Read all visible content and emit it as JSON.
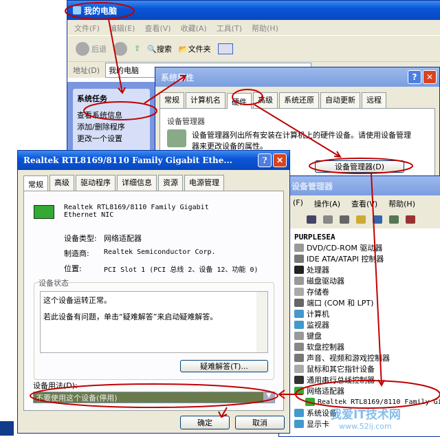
{
  "explorer": {
    "title": "我的电脑",
    "menu": [
      "文件(F)",
      "编辑(E)",
      "查看(V)",
      "收藏(A)",
      "工具(T)",
      "帮助(H)"
    ],
    "back": "后退",
    "search": "搜索",
    "folders": "文件夹",
    "address_label": "地址(D)",
    "address_value": "我的电脑",
    "task_title": "系统任务",
    "tasks": [
      "查看系统信息",
      "添加/删除程序",
      "更改一个设置"
    ]
  },
  "sysprops": {
    "title": "系统属性",
    "tabs": [
      "常规",
      "计算机名",
      "硬件",
      "高级",
      "系统还原",
      "自动更新",
      "远程"
    ],
    "group": "设备管理器",
    "desc": "设备管理器列出所有安装在计算机上的硬件设备。请使用设备管理器来更改设备的属性。",
    "button": "设备管理器(D)"
  },
  "devmgr": {
    "title": "设备管理器",
    "menu": [
      "(F)",
      "操作(A)",
      "查看(V)",
      "帮助(H)"
    ],
    "root": "PURPLESEA",
    "items": [
      "DVD/CD-ROM 驱动器",
      "IDE ATA/ATAPI 控制器",
      "处理器",
      "磁盘驱动器",
      "存储卷",
      "端口 (COM 和 LPT)",
      "计算机",
      "监视器",
      "键盘",
      "软盘控制器",
      "声音、视频和游戏控制器",
      "鼠标和其它指针设备",
      "通用串行总线控制器",
      "网络适配器"
    ],
    "child": "Realtek RTL8169/8110 Family Gi",
    "after": [
      "系统设备",
      "显示卡"
    ]
  },
  "nicprops": {
    "title": "Realtek RTL8169/8110 Family Gigabit Ethe...",
    "tabs": [
      "常规",
      "高级",
      "驱动程序",
      "详细信息",
      "资源",
      "电源管理"
    ],
    "device_name": "Realtek RTL8169/8110 Family Gigabit Ethernet NIC",
    "type_label": "设备类型:",
    "type_value": "网络适配器",
    "mfr_label": "制造商:",
    "mfr_value": "Realtek Semiconductor Corp.",
    "loc_label": "位置:",
    "loc_value": "PCI Slot 1 (PCI 总线 2、设备 12、功能 0)",
    "status_group": "设备状态",
    "status_line1": "这个设备运转正常。",
    "status_line2": "若此设备有问题，单击“疑难解答”来启动疑难解答。",
    "troubleshoot": "疑难解答(T)...",
    "usage_label": "设备用法(D):",
    "usage_value": "不要使用这个设备(停用)",
    "ok": "确定",
    "cancel": "取消"
  },
  "watermark": {
    "name": "我爱IT技术网",
    "url": "www.52ij.com"
  },
  "colors": {
    "annotation": "#c00000",
    "xp_blue": "#0a56d8"
  }
}
